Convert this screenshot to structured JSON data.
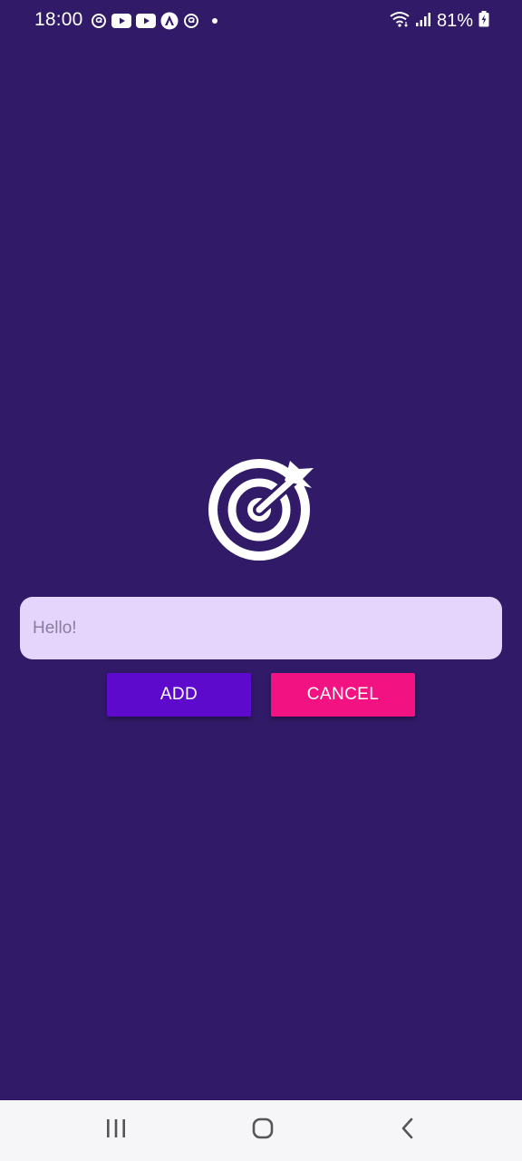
{
  "status_bar": {
    "time": "18:00",
    "battery": "81%",
    "notification_icons": [
      "threads-icon",
      "youtube-icon",
      "youtube-icon",
      "triangle-app-icon",
      "threads-icon",
      "dot-icon"
    ],
    "system_icons": [
      "wifi-icon",
      "signal-icon",
      "battery-charging-icon"
    ]
  },
  "main": {
    "icon": "target-arrow-icon",
    "input": {
      "placeholder": "Hello!",
      "value": ""
    },
    "add_label": "ADD",
    "cancel_label": "CANCEL"
  },
  "nav_bar": {
    "items": [
      "recents-icon",
      "home-icon",
      "back-icon"
    ]
  },
  "colors": {
    "background": "#311b69",
    "input_background": "#e5d5fd",
    "add_button": "#5e0acc",
    "cancel_button": "#f31282",
    "nav_bar": "#f6f5f7"
  }
}
